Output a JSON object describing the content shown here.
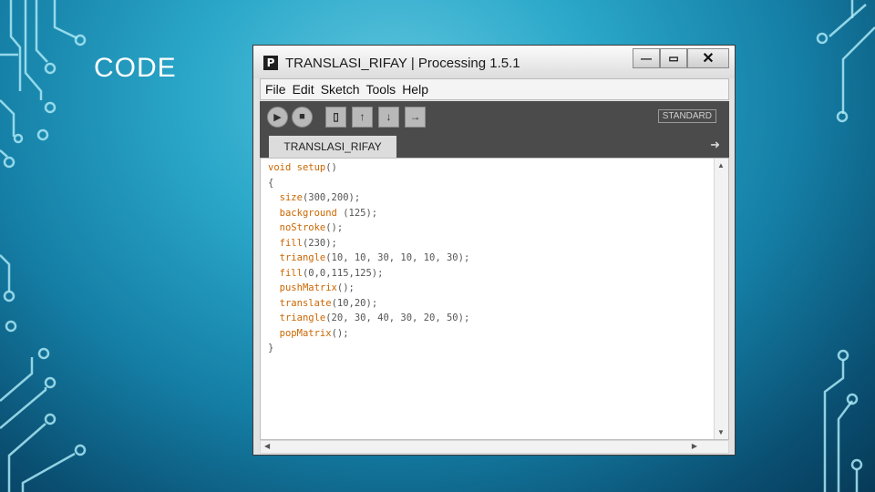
{
  "slide": {
    "title": "CODE"
  },
  "window": {
    "app_icon": "P",
    "title": "TRANSLASI_RIFAY | Processing 1.5.1",
    "controls": {
      "minimize": "—",
      "maximize": "▭",
      "close": "✕"
    }
  },
  "menu": [
    "File",
    "Edit",
    "Sketch",
    "Tools",
    "Help"
  ],
  "toolbar": {
    "buttons": [
      "run-icon",
      "stop-icon",
      "new-icon",
      "open-icon",
      "save-icon",
      "export-icon"
    ],
    "mode": "STANDARD"
  },
  "tab": {
    "label": "TRANSLASI_RIFAY",
    "arrow": "➜"
  },
  "code_lines": [
    [
      [
        "kw",
        "void"
      ],
      [
        "ty",
        " "
      ],
      [
        "kw",
        "setup"
      ],
      [
        "ty",
        "()"
      ]
    ],
    [
      [
        "ty",
        "{"
      ]
    ],
    [
      [
        "ty",
        "  "
      ],
      [
        "kw",
        "size"
      ],
      [
        "ty",
        "(300,200);"
      ]
    ],
    [
      [
        "ty",
        "  "
      ],
      [
        "kw",
        "background"
      ],
      [
        "ty",
        " (125);"
      ]
    ],
    [
      [
        "ty",
        "  "
      ],
      [
        "kw",
        "noStroke"
      ],
      [
        "ty",
        "();"
      ]
    ],
    [
      [
        "ty",
        "  "
      ],
      [
        "kw",
        "fill"
      ],
      [
        "ty",
        "(230);"
      ]
    ],
    [
      [
        "ty",
        "  "
      ],
      [
        "kw",
        "triangle"
      ],
      [
        "ty",
        "(10, 10, 30, 10, 10, 30);"
      ]
    ],
    [
      [
        "ty",
        "  "
      ],
      [
        "kw",
        "fill"
      ],
      [
        "ty",
        "(0,0,115,125);"
      ]
    ],
    [
      [
        "ty",
        "  "
      ],
      [
        "kw",
        "pushMatrix"
      ],
      [
        "ty",
        "();"
      ]
    ],
    [
      [
        "ty",
        "  "
      ],
      [
        "kw",
        "translate"
      ],
      [
        "ty",
        "(10,20);"
      ]
    ],
    [
      [
        "ty",
        "  "
      ],
      [
        "kw",
        "triangle"
      ],
      [
        "ty",
        "(20, 30, 40, 30, 20, 50);"
      ]
    ],
    [
      [
        "ty",
        "  "
      ],
      [
        "kw",
        "popMatrix"
      ],
      [
        "ty",
        "();"
      ]
    ],
    [
      [
        "ty",
        "}"
      ]
    ]
  ],
  "colors": {
    "keyword": "#cc6600",
    "toolbar_bg": "#4b4b4b",
    "editor_bg": "#ffffff"
  }
}
